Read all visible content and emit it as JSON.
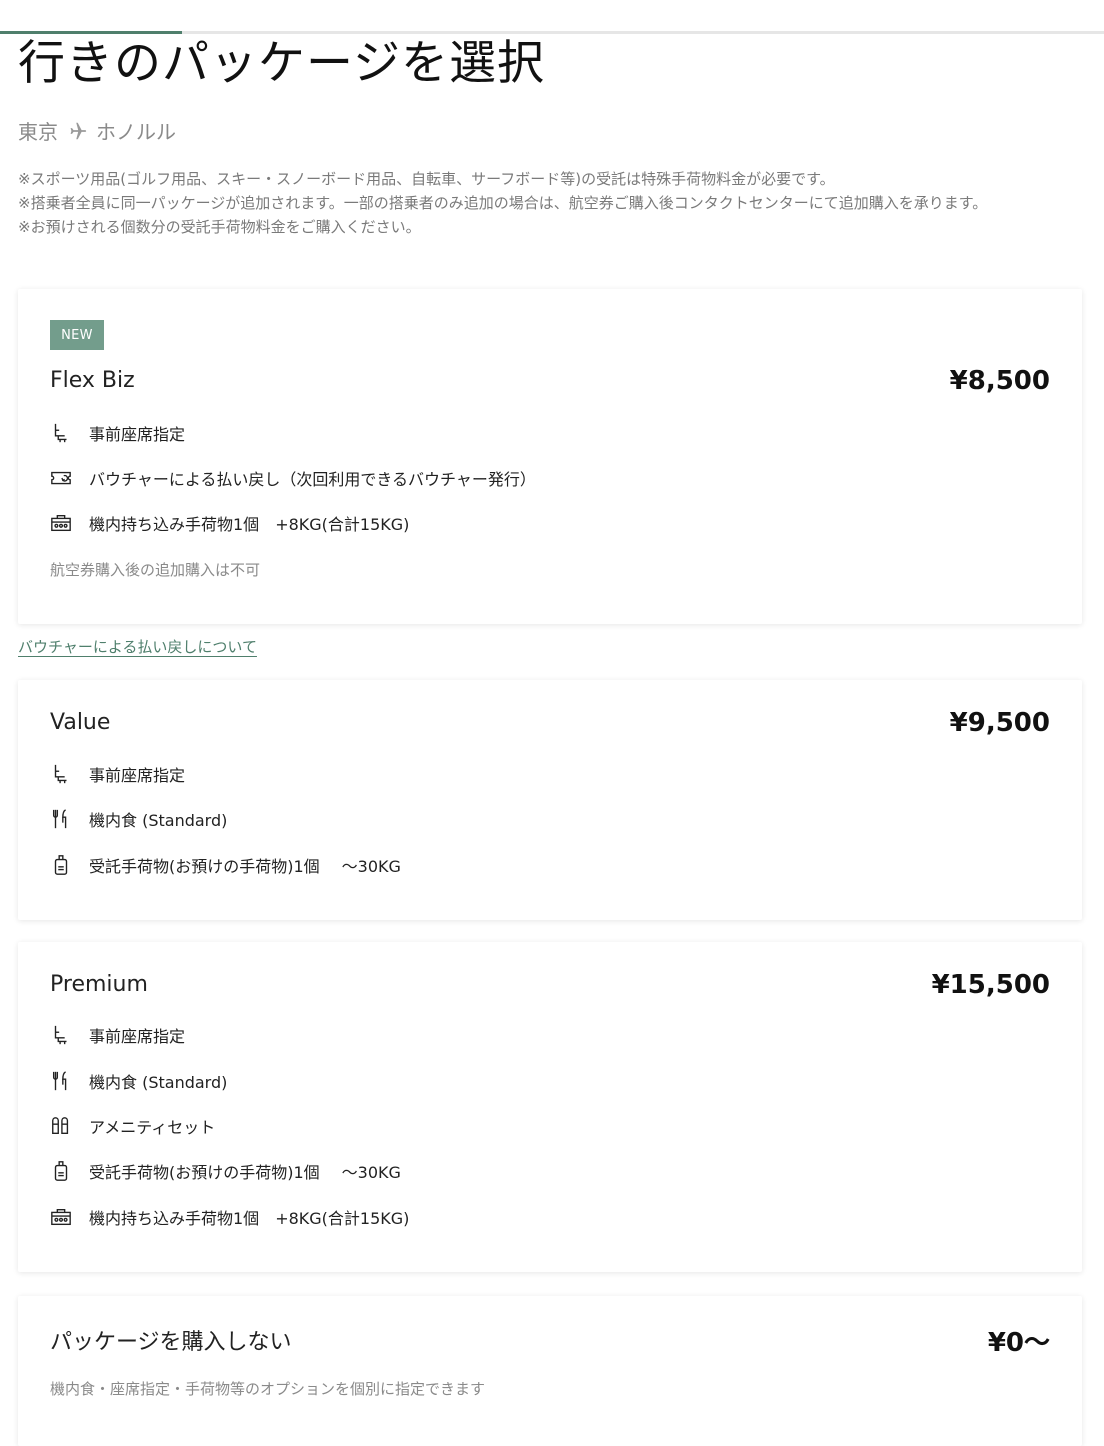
{
  "progress": {
    "fraction": 0.165,
    "color": "#4f7f6c"
  },
  "page_title": "行きのパッケージを選択",
  "route": {
    "origin": "東京",
    "destination": "ホノルル",
    "icon": "plane-icon"
  },
  "notes": [
    "※スポーツ用品(ゴルフ用品、スキー・スノーボード用品、自転車、サーフボード等)の受託は特殊手荷物料金が必要です。",
    "※搭乗者全員に同一パッケージが追加されます。一部の搭乗者のみ追加の場合は、航空券ご購入後コンタクトセンターにて追加購入を承ります。",
    "※お預けされる個数分の受託手荷物料金をご購入ください。"
  ],
  "packages": [
    {
      "badge": "NEW",
      "name": "Flex Biz",
      "price": "¥8,500",
      "features": [
        {
          "icon": "seat-icon",
          "text": "事前座席指定",
          "extra": ""
        },
        {
          "icon": "voucher-icon",
          "text": "バウチャーによる払い戻し（次回利用できるバウチャー発行）",
          "extra": ""
        },
        {
          "icon": "carry-on-bag-icon",
          "text": "機内持ち込み手荷物1個",
          "extra": "+8KG(合計15KG)"
        }
      ],
      "note": "航空券購入後の追加購入は不可"
    },
    {
      "name": "Value",
      "price": "¥9,500",
      "features": [
        {
          "icon": "seat-icon",
          "text": "事前座席指定",
          "extra": ""
        },
        {
          "icon": "meal-icon",
          "text": "機内食 (Standard)",
          "extra": ""
        },
        {
          "icon": "checked-baggage-icon",
          "text": "受託手荷物(お預けの手荷物)1個",
          "extra": "～30KG"
        }
      ]
    },
    {
      "name": "Premium",
      "price": "¥15,500",
      "features": [
        {
          "icon": "seat-icon",
          "text": "事前座席指定",
          "extra": ""
        },
        {
          "icon": "meal-icon",
          "text": "機内食 (Standard)",
          "extra": ""
        },
        {
          "icon": "amenity-icon",
          "text": "アメニティセット",
          "extra": ""
        },
        {
          "icon": "checked-baggage-icon",
          "text": "受託手荷物(お預けの手荷物)1個",
          "extra": "～30KG"
        },
        {
          "icon": "carry-on-bag-icon",
          "text": "機内持ち込み手荷物1個",
          "extra": "+8KG(合計15KG)"
        }
      ]
    },
    {
      "name": "パッケージを購入しない",
      "price": "¥0～",
      "description": "機内食・座席指定・手荷物等のオプションを個別に指定できます"
    }
  ],
  "voucher_link": "バウチャーによる払い戻しについて"
}
